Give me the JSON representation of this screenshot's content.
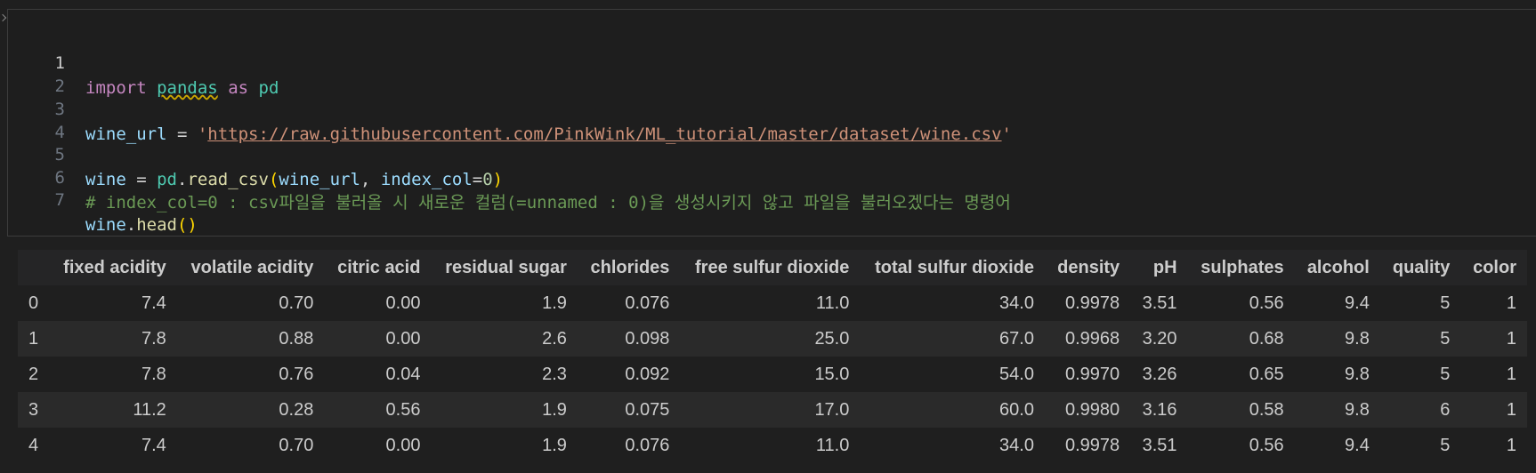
{
  "code_cell": {
    "line_numbers": [
      "1",
      "2",
      "3",
      "4",
      "5",
      "6",
      "7"
    ],
    "line1": {
      "kw_import": "import",
      "module": "pandas",
      "kw_as": "as",
      "alias": "pd"
    },
    "line3": {
      "var": "wine_url",
      "eq": " = ",
      "quote_open": "'",
      "url": "https://raw.githubusercontent.com/PinkWink/ML_tutorial/master/dataset/wine.csv",
      "quote_close": "'"
    },
    "line5": {
      "var": "wine",
      "eq": " = ",
      "obj": "pd",
      "dot": ".",
      "fn": "read_csv",
      "paren_open": "(",
      "arg1": "wine_url",
      "comma": ", ",
      "kwarg": "index_col",
      "eq2": "=",
      "num": "0",
      "paren_close": ")"
    },
    "line6": {
      "comment": "# index_col=0 : csv파일을 불러올 시 새로운 컬럼(=unnamed : 0)을 생성시키지 않고 파일을 불러오겠다는 명령어"
    },
    "line7": {
      "var": "wine",
      "dot": ".",
      "fn": "head",
      "parens": "()"
    }
  },
  "output_table": {
    "columns": [
      "fixed acidity",
      "volatile acidity",
      "citric acid",
      "residual sugar",
      "chlorides",
      "free sulfur dioxide",
      "total sulfur dioxide",
      "density",
      "pH",
      "sulphates",
      "alcohol",
      "quality",
      "color"
    ],
    "rows": [
      {
        "index": "0",
        "values": [
          "7.4",
          "0.70",
          "0.00",
          "1.9",
          "0.076",
          "11.0",
          "34.0",
          "0.9978",
          "3.51",
          "0.56",
          "9.4",
          "5",
          "1"
        ]
      },
      {
        "index": "1",
        "values": [
          "7.8",
          "0.88",
          "0.00",
          "2.6",
          "0.098",
          "25.0",
          "67.0",
          "0.9968",
          "3.20",
          "0.68",
          "9.8",
          "5",
          "1"
        ]
      },
      {
        "index": "2",
        "values": [
          "7.8",
          "0.76",
          "0.04",
          "2.3",
          "0.092",
          "15.0",
          "54.0",
          "0.9970",
          "3.26",
          "0.65",
          "9.8",
          "5",
          "1"
        ]
      },
      {
        "index": "3",
        "values": [
          "11.2",
          "0.28",
          "0.56",
          "1.9",
          "0.075",
          "17.0",
          "60.0",
          "0.9980",
          "3.16",
          "0.58",
          "9.8",
          "6",
          "1"
        ]
      },
      {
        "index": "4",
        "values": [
          "7.4",
          "0.70",
          "0.00",
          "1.9",
          "0.076",
          "11.0",
          "34.0",
          "0.9978",
          "3.51",
          "0.56",
          "9.4",
          "5",
          "1"
        ]
      }
    ]
  }
}
